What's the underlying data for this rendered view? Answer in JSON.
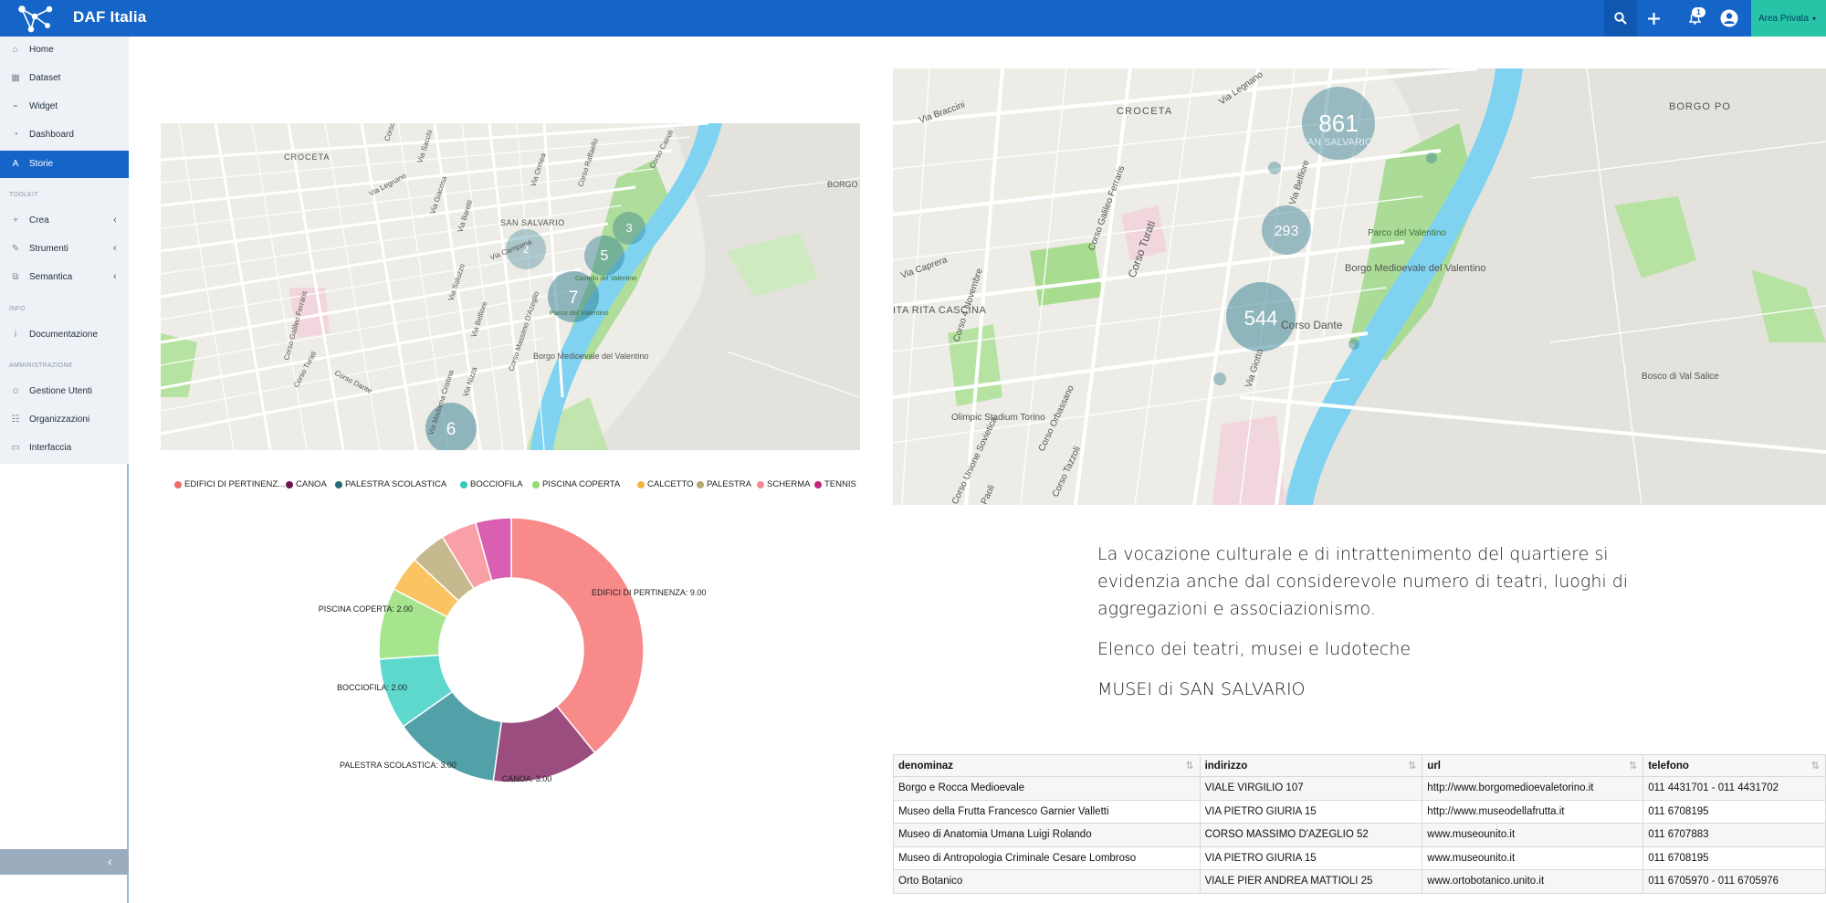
{
  "app": {
    "title": "DAF Italia"
  },
  "topbar": {
    "search_icon": "search-icon",
    "plus_icon": "plus-icon",
    "notifications": {
      "icon": "bell-icon",
      "count": "1"
    },
    "user_icon": "user-circle-icon",
    "area_label": "Area Privata",
    "colors": {
      "bar": "#1565c8",
      "area": "#27c4a8"
    }
  },
  "sidebar": {
    "items": [
      {
        "label": "Home",
        "icon": "home-icon"
      },
      {
        "label": "Dataset",
        "icon": "table-icon"
      },
      {
        "label": "Widget",
        "icon": "chart-icon"
      },
      {
        "label": "Dashboard",
        "icon": "dashboard-icon"
      },
      {
        "label": "Storie",
        "icon": "story-icon",
        "active": true
      }
    ],
    "toolkit_title": "TOOLKIT",
    "toolkit": [
      {
        "label": "Crea",
        "icon": "plus-icon"
      },
      {
        "label": "Strumenti",
        "icon": "wrench-icon"
      },
      {
        "label": "Semantica",
        "icon": "sitemap-icon"
      }
    ],
    "info_title": "INFO",
    "info": [
      {
        "label": "Documentazione",
        "icon": "info-icon"
      }
    ],
    "admin_title": "AMMINISTRAZIONE",
    "admin": [
      {
        "label": "Gestione Utenti",
        "icon": "users-icon"
      },
      {
        "label": "Organizzazioni",
        "icon": "group-icon"
      },
      {
        "label": "Interfaccia",
        "icon": "window-icon"
      }
    ],
    "collapse_glyph": "‹"
  },
  "map_left": {
    "clusters": [
      "2",
      "3",
      "5",
      "7",
      "6"
    ],
    "labels": [
      "CROCETA",
      "SAN SALVARIO",
      "BORGO",
      "Borgo Medioevale del Valentino",
      "Parco del Valentino",
      "Castello del Valentino",
      "Corso Galileo Ferraris",
      "Corso Turati",
      "Corso Dante",
      "Corso Massimo D'Azeglio",
      "Via Madama Cristina",
      "Via Nizza",
      "Via Saluzzo",
      "Via Legnano",
      "Via Sacchi",
      "Via Belfiore",
      "Via Campana",
      "Via Ormea",
      "Corso Cairoli",
      "Corso Raffaello",
      "Via Giacosa",
      "Via Baretti",
      "Corso Turin"
    ]
  },
  "map_right": {
    "clusters": [
      "861",
      "293",
      "544"
    ],
    "labels": [
      "CROCETA",
      "BORGO PO",
      "SAN SALVARIO",
      "Borgo Medioevale del Valentino",
      "Parco del Valentino",
      "Bosco di Val Salice",
      "ITA RITA CASCINA",
      "Olimpic Stadium Torino",
      "Corso Dante",
      "Corso Turati",
      "Corso Galileo Ferraris",
      "Corso 4 Novembre",
      "Corso Unione Sovietica",
      "Via Braccini",
      "Via Legnano",
      "Via Caprera",
      "Via Belfiore",
      "Via Giotto",
      "Corso Orbassano",
      "Corso Tazzoli",
      "Paoli"
    ]
  },
  "chart_data": {
    "type": "pie",
    "donut": true,
    "legend_position": "top",
    "series": [
      {
        "name": "EDIFICI DI PERTINENZA",
        "legend": "EDIFICI DI PERTINENZ...",
        "value": 9.0,
        "label": "EDIFICI DI PERTINENZA: 9.00",
        "color": "#f88a8a"
      },
      {
        "name": "CANOA",
        "legend": "CANOA",
        "value": 3.0,
        "label": "CANOA: 3.00",
        "color": "#9c4d80"
      },
      {
        "name": "PALESTRA SCOLASTICA",
        "legend": "PALESTRA SCOLASTICA",
        "value": 3.0,
        "label": "PALESTRA SCOLASTICA: 3.00",
        "color": "#52a0a8"
      },
      {
        "name": "BOCCIOFILA",
        "legend": "BOCCIOFILA",
        "value": 2.0,
        "label": "BOCCIOFILA: 2.00",
        "color": "#5ed8cd"
      },
      {
        "name": "PISCINA COPERTA",
        "legend": "PISCINA COPERTA",
        "value": 2.0,
        "label": "PISCINA COPERTA: 2.00",
        "color": "#a6e48e"
      },
      {
        "name": "CALCETTO",
        "legend": "CALCETTO",
        "value": 1.0,
        "label": "",
        "color": "#fbc462"
      },
      {
        "name": "PALESTRA",
        "legend": "PALESTRA",
        "value": 1.0,
        "label": "",
        "color": "#c6b98e"
      },
      {
        "name": "SCHERMA",
        "legend": "SCHERMA",
        "value": 1.0,
        "label": "",
        "color": "#f8a0a6"
      },
      {
        "name": "TENNIS",
        "legend": "TENNIS",
        "value": 1.0,
        "label": "",
        "color": "#d95fb2"
      }
    ],
    "legend_dot_colors": [
      "#f06a6a",
      "#6e1650",
      "#236e78",
      "#35c9bd",
      "#8fdc6e",
      "#f4b340",
      "#b5a873",
      "#f48b93",
      "#c2287e"
    ]
  },
  "story": {
    "paragraph": "La vocazione culturale e di intrattenimento del quartiere si evidenzia anche dal considerevole numero di teatri, luoghi di aggregazioni e associazionismo.",
    "subtitle": "Elenco dei teatri, musei e ludoteche",
    "section_title": "MUSEI di SAN SALVARIO"
  },
  "table": {
    "columns": [
      "denominaz",
      "indirizzo",
      "url",
      "telefono"
    ],
    "sort_glyph": "⇅",
    "rows": [
      [
        "Borgo e Rocca Medioevale",
        "VIALE VIRGILIO 107",
        "http://www.borgomedioevaletorino.it",
        "011 4431701 - 011 4431702"
      ],
      [
        "Museo della Frutta Francesco Garnier Valletti",
        "VIA PIETRO GIURIA 15",
        "http://www.museodellafrutta.it",
        "011 6708195"
      ],
      [
        "Museo di Anatomia Umana Luigi Rolando",
        "CORSO MASSIMO D'AZEGLIO 52",
        "www.museounito.it",
        "011 6707883"
      ],
      [
        "Museo di Antropologia Criminale Cesare Lombroso",
        "VIA PIETRO GIURIA 15",
        "www.museounito.it",
        "011 6708195"
      ],
      [
        "Orto Botanico",
        "VIALE PIER ANDREA MATTIOLI 25",
        "www.ortobotanico.unito.it",
        "011 6705970 - 011 6705976"
      ]
    ]
  }
}
